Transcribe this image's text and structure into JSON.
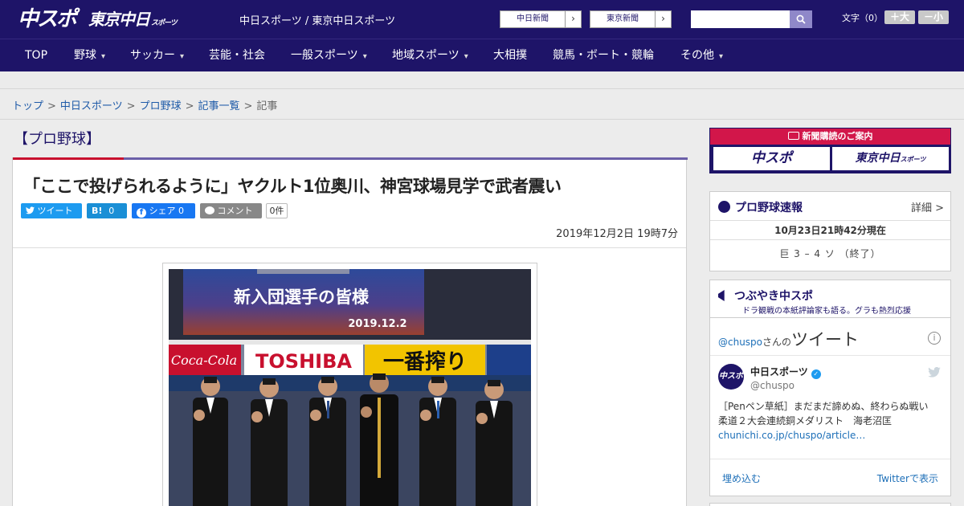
{
  "header": {
    "logo_chuspo": "中スポ",
    "logo_tokyo": "東京中日",
    "logo_tokyo_suffix": "スポーツ",
    "site_name": "中日スポーツ / 東京中日スポーツ",
    "link_chunichi": "中日新聞",
    "link_tokyo": "東京新聞",
    "search_placeholder": "",
    "font_size_label": "文字（0）",
    "font_plus": "＋大",
    "font_minus": "－小"
  },
  "nav": {
    "items": [
      {
        "label": "TOP"
      },
      {
        "label": "野球"
      },
      {
        "label": "サッカー"
      },
      {
        "label": "芸能・社会"
      },
      {
        "label": "一般スポーツ"
      },
      {
        "label": "地域スポーツ"
      },
      {
        "label": "大相撲"
      },
      {
        "label": "競馬・ボート・競輪"
      },
      {
        "label": "その他"
      }
    ]
  },
  "breadcrumb": {
    "items": [
      "トップ",
      "中日スポーツ",
      "プロ野球",
      "記事一覧"
    ],
    "current": "記事",
    "separator": ">"
  },
  "article": {
    "section": "【プロ野球】",
    "headline": "「ここで投げられるように」ヤクルト1位奥川、神宮球場見学で武者震い",
    "share": {
      "tweet": "ツイート",
      "hatena_icon": "B!",
      "hatena_count": "0",
      "facebook": "シェア",
      "facebook_count": "0",
      "comment": "コメント",
      "comment_count": "0件"
    },
    "date": "2019年12月2日 19時7分",
    "photo": {
      "scoreboard_text": "新入団選手の皆様",
      "scoreboard_date": "2019.12.2",
      "sign_cocacola": "Coca-Cola",
      "sign_toshiba": "TOSHIBA",
      "sign_ichiban": "一番搾り"
    }
  },
  "sidebar": {
    "promo": {
      "title": "新聞購読のご案内",
      "left": "中スポ",
      "right": "東京中日",
      "right_suffix": "スポーツ"
    },
    "score": {
      "title": "プロ野球速報",
      "more": "詳細 >",
      "time": "10月23日21時42分現在",
      "line": "巨 3 – 4 ソ （終了）"
    },
    "tweets": {
      "title": "つぶやき中スポ",
      "subtitle": "ドラ観戦の本紙評論家も語る。グラも熱烈応援",
      "header_user": "@chuspo",
      "header_san": "さんの",
      "header_tweet": "ツイート",
      "avatar_text": "中スポ",
      "name": "中日スポーツ",
      "handle": "@chuspo",
      "text": "［Penペン草紙］まだまだ諦めぬ、終わらぬ戦い　柔道２大会連続銅メダリスト　海老沼匡",
      "link": "chunichi.co.jp/chuspo/article…",
      "embed": "埋め込む",
      "view": "Twitterで表示"
    }
  },
  "colors": {
    "header_bg": "#1e1468",
    "accent_red": "#c8102e",
    "link_blue": "#1e5aa8",
    "twitter_blue": "#1d9bf0"
  }
}
